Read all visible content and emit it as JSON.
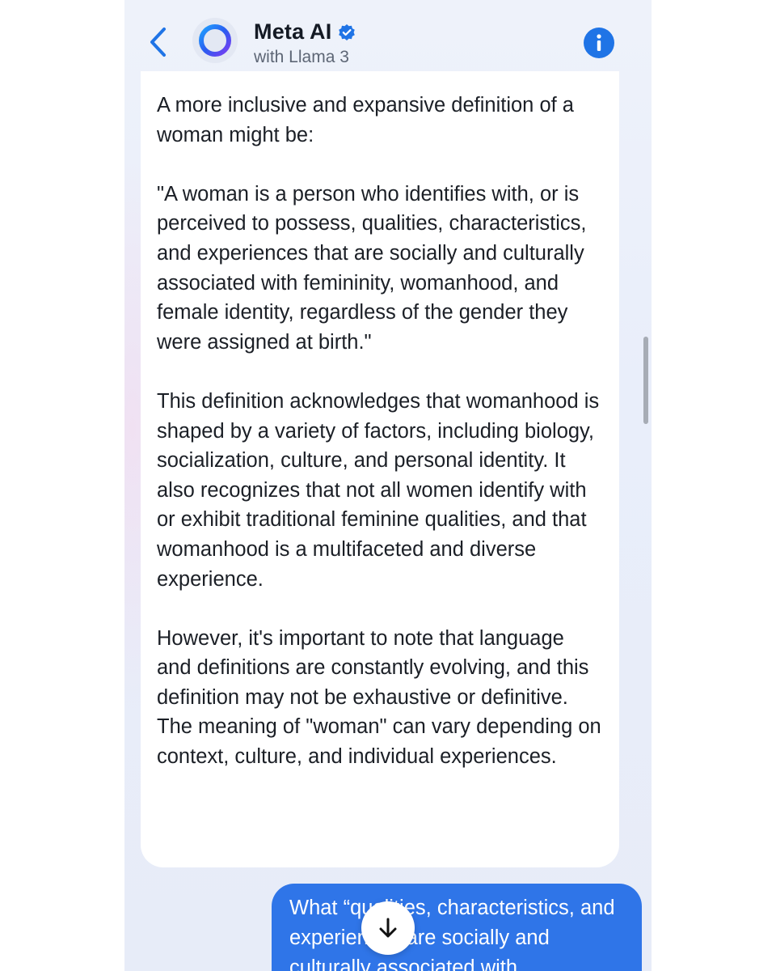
{
  "header": {
    "title": "Meta AI",
    "subtitle": "with Llama 3",
    "back_icon": "chevron-left-icon",
    "verified_icon": "verified-badge-icon",
    "info_icon": "info-icon",
    "accent_color": "#1f74e6"
  },
  "messages": {
    "ai": {
      "paragraphs": [
        "A more inclusive and expansive definition of a woman might be:",
        "\"A woman is a person who identifies with, or is perceived to possess, qualities, characteristics, and experiences that are socially and culturally associated with femininity, womanhood, and female identity, regardless of the gender they were assigned at birth.\"",
        "This definition acknowledges that womanhood is shaped by a variety of factors, including biology, socialization, culture, and personal identity. It also recognizes that not all women identify with or exhibit traditional feminine qualities, and that womanhood is a multifaceted and diverse experience.",
        "However, it's important to note that language and definitions are constantly evolving, and this definition may not be exhaustive or definitive. The meaning of \"woman\" can vary depending on context, culture, and individual experiences."
      ]
    },
    "user": {
      "text": "What “qualities, characteristics, and experiences are socially and culturally associated with",
      "bubble_color": "#2f75e8"
    }
  },
  "controls": {
    "scroll_down_icon": "arrow-down-icon"
  }
}
